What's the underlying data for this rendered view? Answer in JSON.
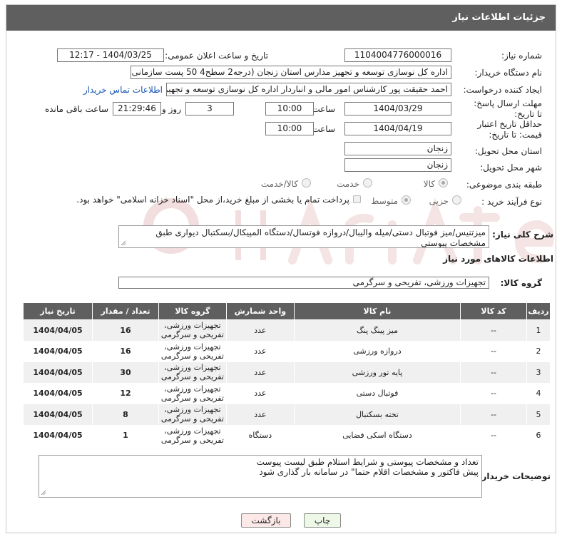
{
  "header": {
    "title": "جزئیات اطلاعات نیاز"
  },
  "form": {
    "need_number_label": "شماره نیاز:",
    "need_number": "1104004776000016",
    "announce_label": "تاریخ و ساعت اعلان عمومی:",
    "announce_value": "1404/03/25 - 12:17",
    "buyer_label": "نام دستگاه خریدار:",
    "buyer_value": "اداره کل نوسازی   توسعه و تجهیز مدارس استان زنجان (درجه2  سطح4  50 پست سازمانی",
    "creator_label": "ایجاد کننده درخواست:",
    "creator_value": "احمد حقیقت پور کارشناس امور مالی و انباردار اداره کل نوسازی   توسعه و تجهیز",
    "contact_link": "اطلاعات تماس خریدار",
    "send_deadline_label": "مهلت ارسال پاسخ: تا تاریخ:",
    "send_date": "1404/03/29",
    "time_label": "ساعت",
    "send_time": "10:00",
    "days_value": "3",
    "days_label": "روز و",
    "remaining_time": "21:29:46",
    "remaining_label": "ساعت باقی مانده",
    "validity_label": "حداقل تاریخ اعتبار قیمت: تا تاریخ:",
    "validity_date": "1404/04/19",
    "validity_time": "10:00",
    "province_label": "استان محل تحویل:",
    "province_value": "زنجان",
    "city_label": "شهر محل تحویل:",
    "city_value": "زنجان",
    "category_label": "طبقه بندی موضوعی:",
    "category_options": [
      "کالا",
      "خدمت",
      "کالا/خدمت"
    ],
    "purchase_type_label": "نوع فرآیند خرید :",
    "purchase_options": [
      "جزیی",
      "متوسط"
    ],
    "payment_note": "پرداخت تمام یا بخشی از مبلغ خرید،از محل \"اسناد خزانه اسلامی\" خواهد بود."
  },
  "description": {
    "label": "شرح کلی نیاز:",
    "text": "میزتنیس/میز فوتبال دستی/میله والیبال/دروازه فوتسال/دستگاه المپیکال/بسکتبال دیواری طبق مشخصات پیوستی"
  },
  "goods": {
    "section_title": "اطلاعات کالاهای مورد نیاز",
    "group_label": "گروه کالا:",
    "group_value": "تجهیزات ورزشی، تفریحی و سرگرمی",
    "columns": [
      "ردیف",
      "کد کالا",
      "نام کالا",
      "واحد شمارش",
      "گروه کالا",
      "تعداد / مقدار",
      "تاریخ نیاز"
    ],
    "rows": [
      [
        "1",
        "--",
        "میز پینگ پنگ",
        "عدد",
        "تجهیزات ورزشی، تفریحی و سرگرمی",
        "16",
        "1404/04/05"
      ],
      [
        "2",
        "--",
        "دروازه ورزشی",
        "عدد",
        "تجهیزات ورزشی، تفریحی و سرگرمی",
        "16",
        "1404/04/05"
      ],
      [
        "3",
        "--",
        "پایه تور ورزشی",
        "عدد",
        "تجهیزات ورزشی، تفریحی و سرگرمی",
        "30",
        "1404/04/05"
      ],
      [
        "4",
        "--",
        "فوتبال دستی",
        "عدد",
        "تجهیزات ورزشی، تفریحی و سرگرمی",
        "12",
        "1404/04/05"
      ],
      [
        "5",
        "--",
        "تخته بسکتبال",
        "عدد",
        "تجهیزات ورزشی، تفریحی و سرگرمی",
        "8",
        "1404/04/05"
      ],
      [
        "6",
        "--",
        "دستگاه اسکی فضایی",
        "دستگاه",
        "تجهیزات ورزشی، تفریحی و سرگرمی",
        "1",
        "1404/04/05"
      ]
    ]
  },
  "buyer_notes": {
    "label": "توضیحات خریدار:",
    "line1": "تعداد و مشخصات پیوستی  و شرایط استلام طبق لیست پیوست",
    "line2": "پیش فاکتور و مشخصات اقلام حتما\" در سامانه بار گذاری شود"
  },
  "buttons": {
    "print": "چاپ",
    "back": "بازگشت"
  },
  "colors": {
    "header_bg": "#5f5f5f",
    "link": "#1a55b5",
    "back_bg": "#fde8e8",
    "print_bg": "#eef8e6"
  }
}
